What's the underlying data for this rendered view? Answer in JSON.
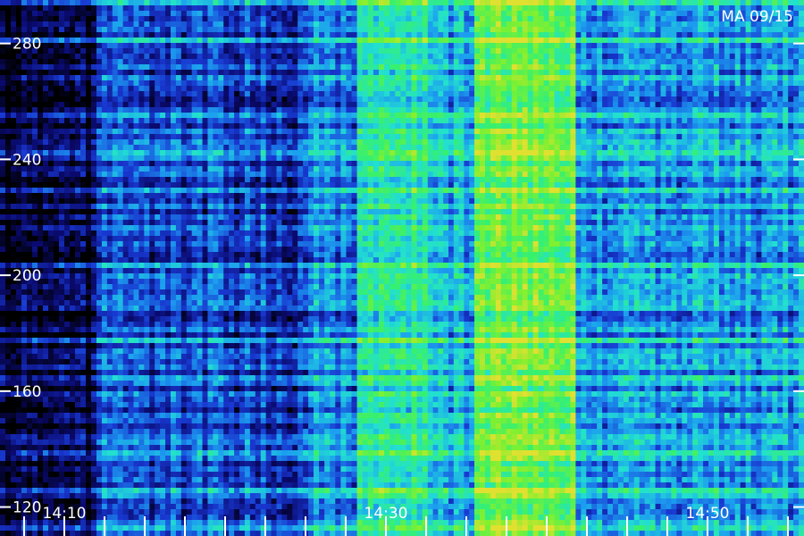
{
  "chart_data": {
    "type": "heatmap",
    "title": "",
    "annotation": "MA 09/15",
    "xlabel": "",
    "ylabel": "",
    "x_axis": {
      "type": "time",
      "labeled_ticks": [
        "14:10",
        "14:30",
        "14:50"
      ],
      "range": [
        "14:06",
        "14:56"
      ]
    },
    "y_axis": {
      "labeled_ticks": [
        120,
        160,
        200,
        240,
        280
      ],
      "range": [
        110,
        295
      ]
    },
    "grid": false,
    "colormap": [
      "#000000",
      "#0a0a6e",
      "#1838d0",
      "#1c9cf0",
      "#22e0d0",
      "#36f070",
      "#80f030",
      "#e0e030"
    ],
    "bands": [
      {
        "x_start": "14:06.0",
        "x_end": "14:12.0",
        "mean": 0.06
      },
      {
        "x_start": "14:12.0",
        "x_end": "14:25.5",
        "mean": 0.28
      },
      {
        "x_start": "14:25.5",
        "x_end": "14:28.2",
        "mean": 0.4
      },
      {
        "x_start": "14:28.2",
        "x_end": "14:32.6",
        "mean": 0.62
      },
      {
        "x_start": "14:32.6",
        "x_end": "14:35.5",
        "mean": 0.45
      },
      {
        "x_start": "14:35.5",
        "x_end": "14:41.8",
        "mean": 0.8
      },
      {
        "x_start": "14:41.8",
        "x_end": "14:56.0",
        "mean": 0.42
      }
    ]
  }
}
